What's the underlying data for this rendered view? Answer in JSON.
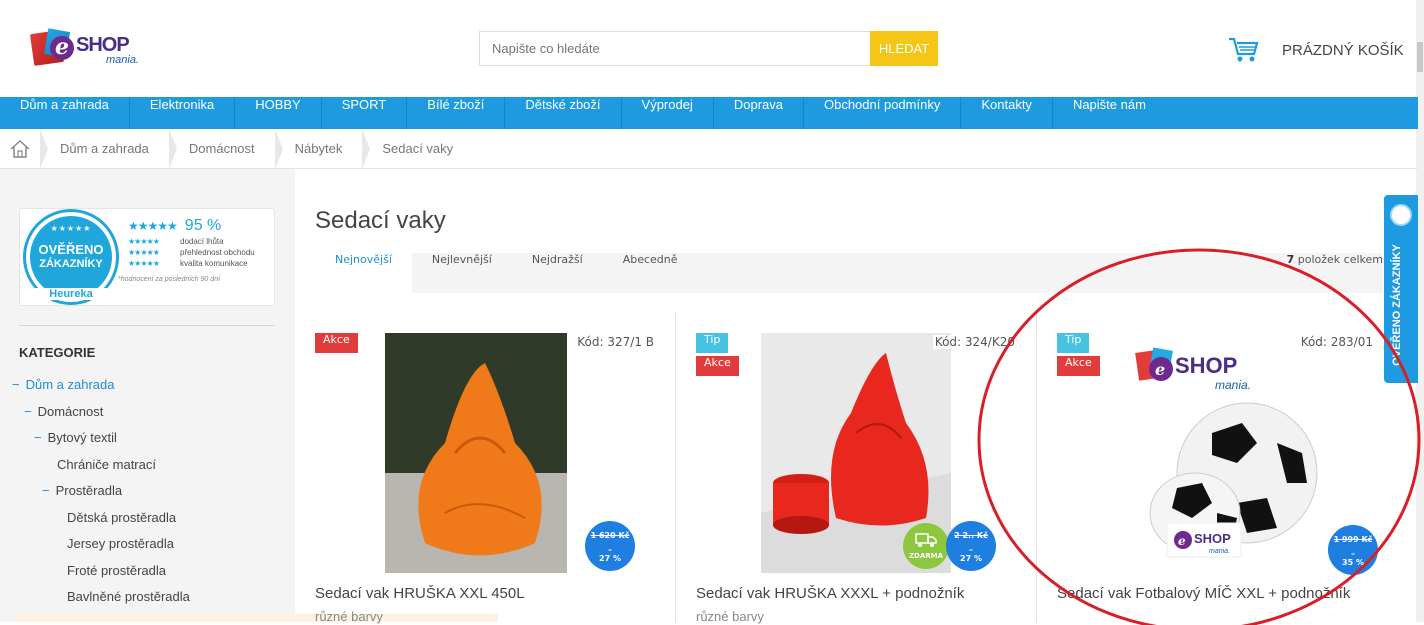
{
  "header": {
    "logo_shop": "SHOP",
    "logo_mania": "mania.",
    "search_placeholder": "Napište co hledáte",
    "search_button": "HLEDAT",
    "cart_label": "PRÁZDNÝ KOŠÍK"
  },
  "nav": {
    "items": [
      "Dům a zahrada",
      "Elektronika",
      "HOBBY",
      "SPORT",
      "Bílé zboží",
      "Dětské zboží",
      "Výprodej",
      "Doprava",
      "Obchodní podmínky",
      "Kontakty",
      "Napište nám"
    ]
  },
  "breadcrumb": [
    "Dům a zahrada",
    "Domácnost",
    "Nábytek",
    "Sedací vaky"
  ],
  "heureka": {
    "seal_line1": "OVĚŘENO",
    "seal_line2": "ZÁKAZNÍKY",
    "seal_brand": "Heureka",
    "score": "95 %",
    "rows": [
      "dodací lhůta",
      "přehlednost obchodu",
      "kvalita komunikace"
    ],
    "note": "*hodnocení za posledních 90 dní"
  },
  "sidebar": {
    "heading": "KATEGORIE",
    "tree": [
      {
        "label": "Dům a zahrada",
        "level": 0,
        "prefix": "−"
      },
      {
        "label": "Domácnost",
        "level": 1,
        "prefix": "−"
      },
      {
        "label": "Bytový textil",
        "level": 2,
        "prefix": "−"
      },
      {
        "label": "Chrániče matrací",
        "level": 3,
        "prefix": ""
      },
      {
        "label": "Prostěradla",
        "level": 3,
        "prefix": "−"
      },
      {
        "label": "Dětská prostěradla",
        "level": 4,
        "prefix": ""
      },
      {
        "label": "Jersey prostěradla",
        "level": 4,
        "prefix": ""
      },
      {
        "label": "Froté prostěradla",
        "level": 4,
        "prefix": ""
      },
      {
        "label": "Bavlněné prostěradla",
        "level": 4,
        "prefix": ""
      }
    ]
  },
  "main": {
    "title": "Sedací vaky",
    "tabs": [
      "Nejnovější",
      "Nejlevnější",
      "Nejdražší",
      "Abecedně"
    ],
    "active_tab": "Nejnovější",
    "count_number": "7",
    "count_text": " položek celkem"
  },
  "products": [
    {
      "badges": [
        "Akce"
      ],
      "code": "Kód: 327/1 B",
      "old_price": "1 620 Kč",
      "dash": "–",
      "discount": "27 %",
      "title": "Sedací vak HRUŠKA XXL 450L",
      "subtitle": "různé barvy",
      "free_shipping": false,
      "color": "#f07a1a"
    },
    {
      "badges": [
        "Tip",
        "Akce"
      ],
      "code": "Kód: 324/K20",
      "old_price": "2 2.. Kč",
      "dash": "–",
      "discount": "27 %",
      "title": "Sedací vak HRUŠKA XXXL + podnožník",
      "subtitle": "různé barvy",
      "free_shipping": true,
      "shipping_label": "ZDARMA",
      "color": "#e8281e"
    },
    {
      "badges": [
        "Tip",
        "Akce"
      ],
      "code": "Kód: 283/01",
      "old_price": "1 999 Kč",
      "dash": "–",
      "discount": "35 %",
      "title": "Sedací vak Fotbalový MÍČ XXL + podnožník",
      "subtitle": "",
      "free_shipping": false,
      "color": "#222222"
    }
  ],
  "side_tab": {
    "label": "OVĚŘENO ZÁKAZNÍKY"
  },
  "colors": {
    "accent": "#1e9be0",
    "search_button": "#f5c518",
    "badge_akce": "#e23b3b",
    "badge_tip": "#46c3e0",
    "annotation": "#d81e28"
  }
}
